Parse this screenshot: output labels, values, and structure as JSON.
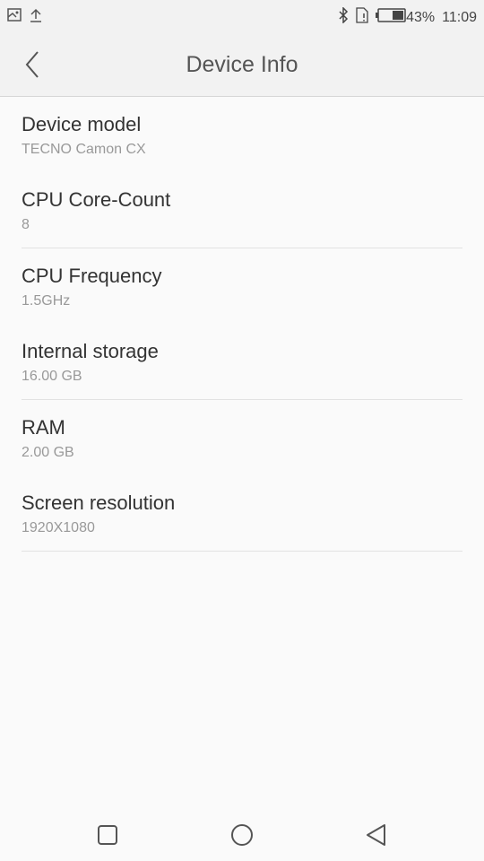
{
  "status_bar": {
    "left_icons": [
      "screenshot-icon",
      "upload-icon"
    ],
    "right_icons": [
      "bluetooth-icon",
      "sim-alert-icon",
      "battery-icon"
    ],
    "battery_percent": "43%",
    "battery_level": 0.43,
    "time": "11:09"
  },
  "header": {
    "back_icon": "chevron-left-icon",
    "title": "Device Info"
  },
  "items": [
    {
      "label": "Device model",
      "value": "TECNO Camon CX"
    },
    {
      "label": "CPU Core-Count",
      "value": "8"
    },
    {
      "label": "CPU Frequency",
      "value": "1.5GHz"
    },
    {
      "label": "Internal storage",
      "value": "16.00 GB"
    },
    {
      "label": "RAM",
      "value": "2.00 GB"
    },
    {
      "label": "Screen resolution",
      "value": "1920X1080"
    }
  ],
  "nav_bar": {
    "buttons": [
      "recents-icon",
      "home-icon",
      "back-icon"
    ]
  }
}
